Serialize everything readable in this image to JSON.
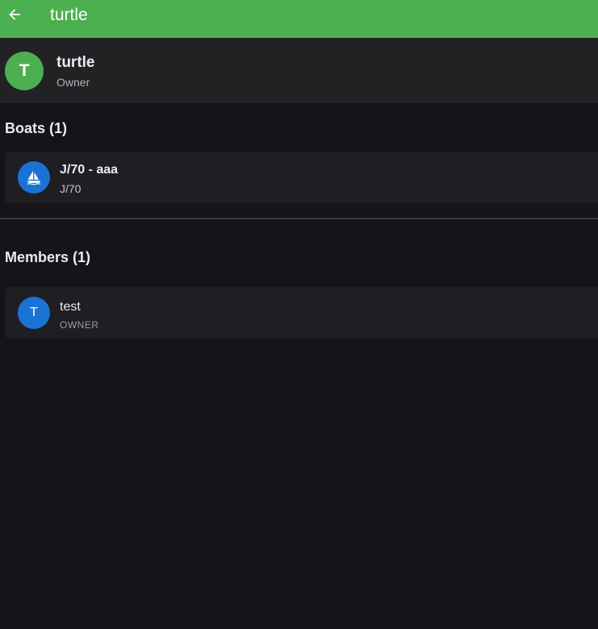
{
  "appbar": {
    "title": "turtle",
    "back_icon": "arrow-left-icon",
    "color": "#4caf50"
  },
  "group": {
    "avatar_letter": "T",
    "name": "turtle",
    "role": "Owner"
  },
  "boats": {
    "heading": "Boats (1)",
    "items": [
      {
        "icon": "sailboat-icon",
        "title": "J/70 - aaa",
        "subtitle": "J/70"
      }
    ]
  },
  "members": {
    "heading": "Members (1)",
    "items": [
      {
        "avatar_letter": "T",
        "name": "test",
        "role": "OWNER"
      }
    ]
  }
}
